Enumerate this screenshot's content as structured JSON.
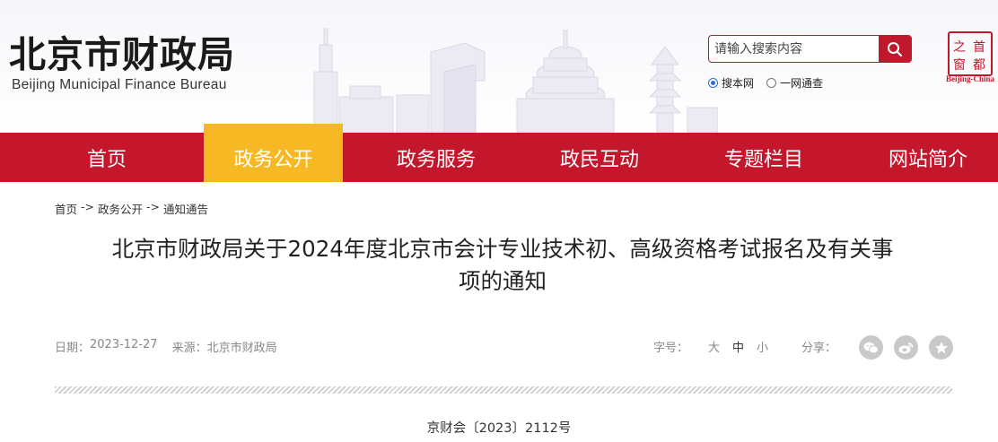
{
  "header": {
    "logo_cn": "北京市财政局",
    "logo_en": "Beijing Municipal Finance Bureau",
    "search": {
      "placeholder": "请输入搜索内容",
      "value": ""
    },
    "search_scope": [
      {
        "label": "搜本网",
        "checked": true
      },
      {
        "label": "一网通查",
        "checked": false
      }
    ],
    "seal": {
      "chars": [
        "首",
        "都",
        "之",
        "窗"
      ],
      "subtitle": "Beijing-China"
    }
  },
  "nav": {
    "items": [
      {
        "label": "首页",
        "active": false
      },
      {
        "label": "政务公开",
        "active": true
      },
      {
        "label": "政务服务",
        "active": false
      },
      {
        "label": "政民互动",
        "active": false
      },
      {
        "label": "专题栏目",
        "active": false
      },
      {
        "label": "网站简介",
        "active": false
      }
    ]
  },
  "breadcrumb": [
    "首页",
    "->",
    "政务公开",
    "->",
    "通知通告"
  ],
  "article": {
    "title_line1": "北京市财政局关于2024年度北京市会计专业技术初、高级资格考试报名及有关事",
    "title_line2": "项的通知",
    "date_label": "日期：",
    "date": "2023-12-27",
    "source_label": "来源：",
    "source": "北京市财政局",
    "font_size_label": "字号：",
    "font_sizes": [
      "大",
      "中",
      "小"
    ],
    "current_font_size": "中",
    "share_label": "分享：",
    "share_targets": [
      "wechat-icon",
      "weibo-icon",
      "qzone-star-icon"
    ],
    "doc_number": "京财会〔2023〕2112号"
  },
  "colors": {
    "brand_red": "#c4172c",
    "active_gold": "#f6b923",
    "radio_blue": "#2a6fd6"
  }
}
